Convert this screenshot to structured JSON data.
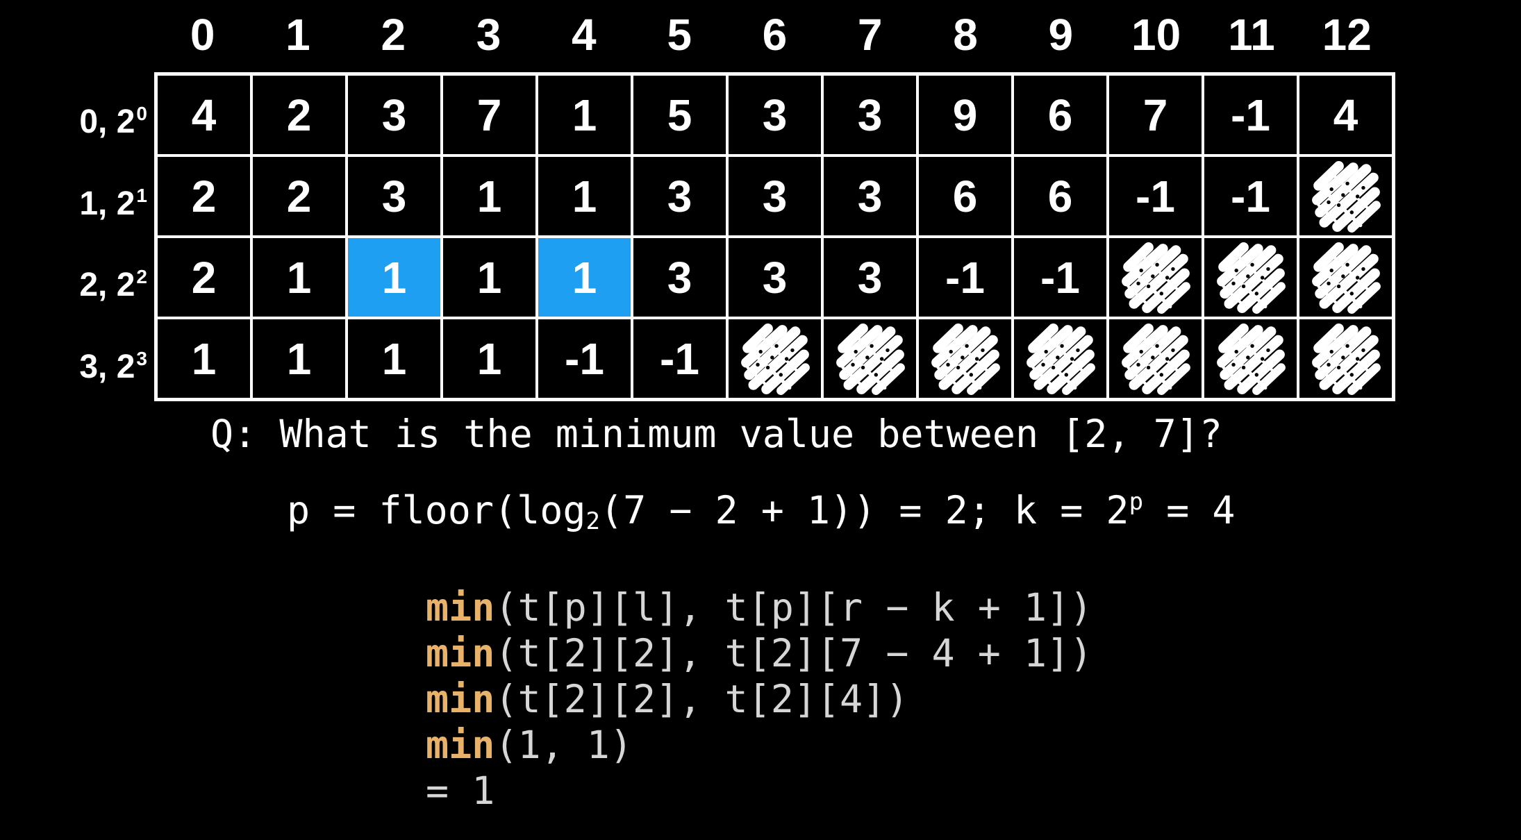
{
  "columns": [
    "0",
    "1",
    "2",
    "3",
    "4",
    "5",
    "6",
    "7",
    "8",
    "9",
    "10",
    "11",
    "12"
  ],
  "rows": [
    {
      "label": "0, 2",
      "exp": "0",
      "cells": [
        "4",
        "2",
        "3",
        "7",
        "1",
        "5",
        "3",
        "3",
        "9",
        "6",
        "7",
        "-1",
        "4"
      ]
    },
    {
      "label": "1, 2",
      "exp": "1",
      "cells": [
        "2",
        "2",
        "3",
        "1",
        "1",
        "3",
        "3",
        "3",
        "6",
        "6",
        "-1",
        "-1",
        ""
      ]
    },
    {
      "label": "2, 2",
      "exp": "2",
      "cells": [
        "2",
        "1",
        "1",
        "1",
        "1",
        "3",
        "3",
        "3",
        "-1",
        "-1",
        "",
        "",
        ""
      ]
    },
    {
      "label": "3, 2",
      "exp": "3",
      "cells": [
        "1",
        "1",
        "1",
        "1",
        "-1",
        "-1",
        "",
        "",
        "",
        "",
        "",
        "",
        ""
      ]
    }
  ],
  "highlight": {
    "row": 2,
    "cols": [
      2,
      4
    ],
    "color": "#1e9ff1"
  },
  "scribble_cells": "cells with no value are drawn as white scribble-icons",
  "question": "Q: What is the minimum value between [2, 7]?",
  "formula": {
    "part1": "p = floor(log",
    "sub": "2",
    "part2": "(7 − 2 + 1)) = 2; k = 2",
    "sup": "p",
    "part3": " = 4"
  },
  "code": [
    {
      "kw": "min",
      "rest": "(t[p][l], t[p][r − k + 1])"
    },
    {
      "kw": "min",
      "rest": "(t[2][2], t[2][7 − 4 + 1])"
    },
    {
      "kw": "min",
      "rest": "(t[2][2], t[2][4])"
    },
    {
      "kw": "min",
      "rest": "(1, 1)"
    },
    {
      "kw": "",
      "rest": "= 1"
    }
  ],
  "colors": {
    "keyword": "#e9b26a",
    "code_text": "#d6d6d6",
    "highlight": "#1e9ff1",
    "background": "#000000"
  }
}
